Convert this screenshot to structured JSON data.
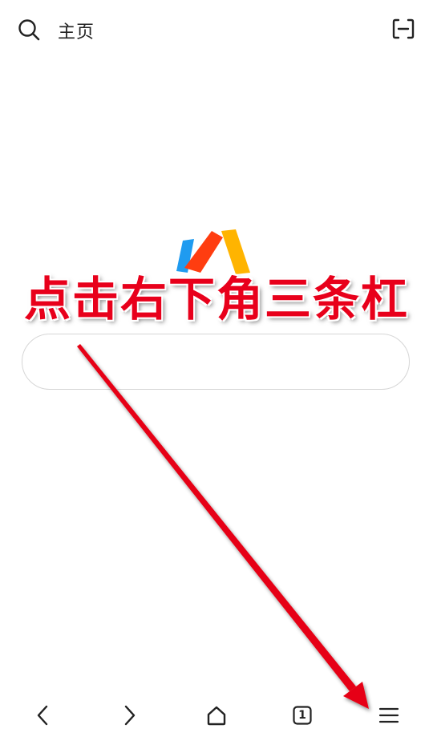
{
  "header": {
    "title": "主页",
    "search_icon": "search-icon",
    "scan_icon": "scan-icon"
  },
  "logo": {
    "name": "browser-logo"
  },
  "annotation": {
    "text": "点击右下角三条杠",
    "color": "#e8001b"
  },
  "search_box": {
    "value": ""
  },
  "bottom_nav": {
    "tab_count": "1",
    "icons": [
      "back-icon",
      "forward-icon",
      "home-icon",
      "tabs-icon",
      "menu-icon"
    ]
  },
  "colors": {
    "logo_blue": "#1f9bf0",
    "logo_orange": "#ff3d10",
    "logo_yellow": "#ffb400",
    "arrow_red": "#e60012"
  }
}
